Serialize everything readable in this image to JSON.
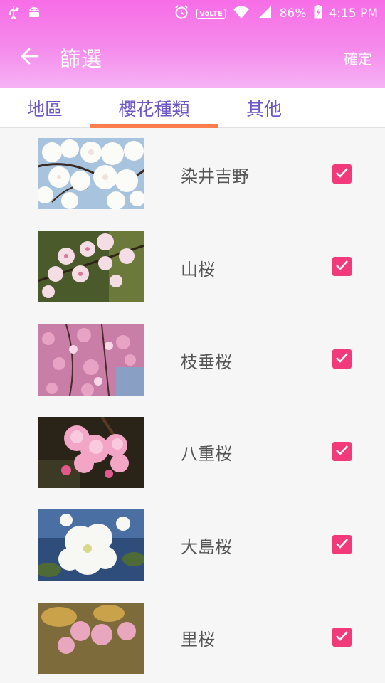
{
  "status_bar": {
    "left_icons": [
      "usb-icon",
      "android-icon"
    ],
    "right_icons": [
      "alarm-icon",
      "volte-icon",
      "wifi-icon",
      "signal-icon",
      "battery-icon"
    ],
    "volte_label": "VoLTE",
    "battery": "86%",
    "time": "4:15 PM"
  },
  "appbar": {
    "title": "篩選",
    "confirm": "確定",
    "back_icon": "arrow-back-icon"
  },
  "tabs": [
    {
      "label": "地區",
      "selected": false
    },
    {
      "label": "櫻花種類",
      "selected": true
    },
    {
      "label": "其他",
      "selected": false
    }
  ],
  "items": [
    {
      "label": "染井吉野",
      "checked": true
    },
    {
      "label": "山桜",
      "checked": true
    },
    {
      "label": "枝垂桜",
      "checked": true
    },
    {
      "label": "八重桜",
      "checked": true
    },
    {
      "label": "大島桜",
      "checked": true
    },
    {
      "label": "里桜",
      "checked": true
    }
  ],
  "colors": {
    "header_top": "#f76de6",
    "header_bottom": "#f6b3f5",
    "tab_text": "#6c56c8",
    "tab_indicator": "#ff7e4f",
    "checkbox": "#f23a7b"
  }
}
